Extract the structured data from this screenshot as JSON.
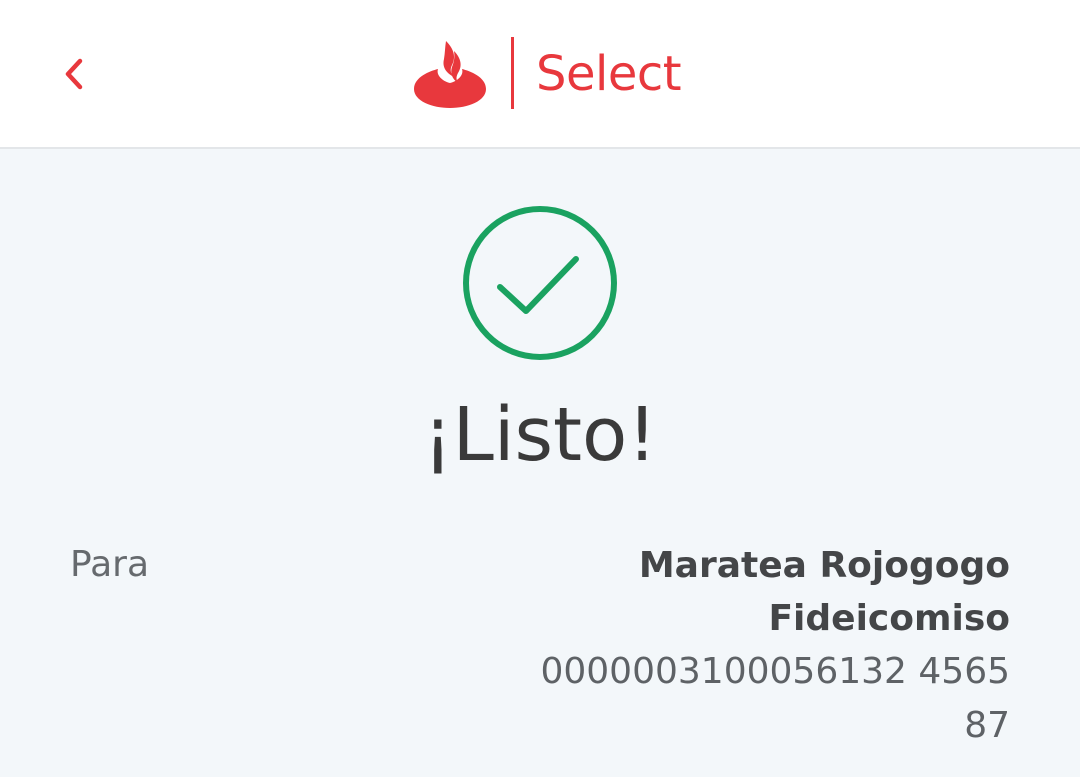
{
  "header": {
    "back_icon": "chevron-left-icon",
    "brand_name": "Select",
    "brand_color": "#e8383d",
    "logo_icon": "santander-flame-icon"
  },
  "status": {
    "icon": "check-circle-icon",
    "icon_color": "#1aa260",
    "title": "¡Listo!"
  },
  "details": {
    "label": "Para",
    "recipient_line1": "Maratea Rojogogo",
    "recipient_line2": "Fideicomiso",
    "account_line1": "0000003100056132 4565",
    "account_line2": "87"
  }
}
